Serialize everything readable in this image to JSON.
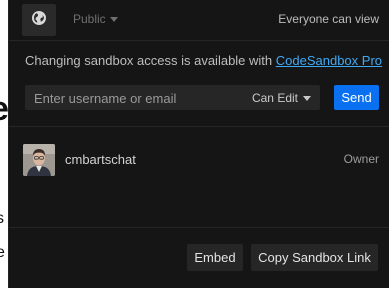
{
  "header": {
    "access_level": "Public",
    "access_status": "Everyone can view"
  },
  "notice": {
    "text": "Changing sandbox access is available with ",
    "link": "CodeSandbox Pro"
  },
  "invite": {
    "placeholder": "Enter username or email",
    "permission": "Can Edit",
    "send_label": "Send"
  },
  "members": [
    {
      "username": "cmbartschat",
      "role": "Owner"
    }
  ],
  "footer": {
    "embed_label": "Embed",
    "copy_label": "Copy Sandbox Link"
  },
  "background_page": {
    "fragment_large": "e",
    "fragment_1": "s",
    "fragment_2": "e"
  },
  "colors": {
    "panel": "#151515",
    "accent": "#0971f1",
    "link": "#40a9f3"
  }
}
